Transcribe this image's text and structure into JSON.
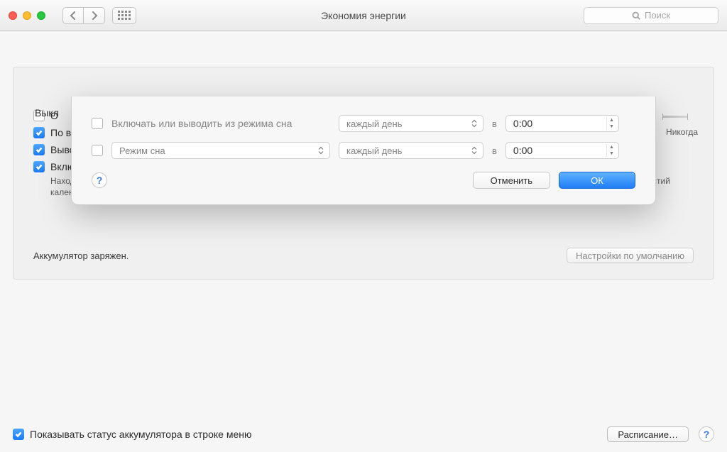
{
  "window": {
    "title": "Экономия энергии",
    "search_placeholder": "Поиск"
  },
  "background": {
    "left_label_truncated": "Выкл",
    "slider_right_label": "Никогда",
    "row0_truncated": "О",
    "checkboxes": [
      {
        "label": "По возможности переводить диски в режим сна",
        "checked": true
      },
      {
        "label": "Выводить из режима сна для доступа по сети Wi-Fi",
        "checked": true
      },
      {
        "label": "Включить Power Nap при подключении к сетевому адаптеру",
        "checked": true
      }
    ],
    "power_nap_description": "Находясь в режиме сна, Mac может выполнять резервное копирование Time Machine и периодически проверять наличие новых сообщений почты, событий календаря и других обновлений iCloud.",
    "battery_status": "Аккумулятор заряжен.",
    "restore_defaults": "Настройки по умолчанию"
  },
  "footer": {
    "show_battery_in_menu": "Показывать статус аккумулятора в строке меню",
    "schedule_button": "Расписание…"
  },
  "sheet": {
    "row1": {
      "label": "Включать или выводить из режима сна",
      "day": "каждый день",
      "at": "в",
      "time": "0:00",
      "checked": false
    },
    "row2": {
      "mode": "Режим сна",
      "day": "каждый день",
      "at": "в",
      "time": "0:00",
      "checked": false
    },
    "cancel": "Отменить",
    "ok": "ОК"
  }
}
